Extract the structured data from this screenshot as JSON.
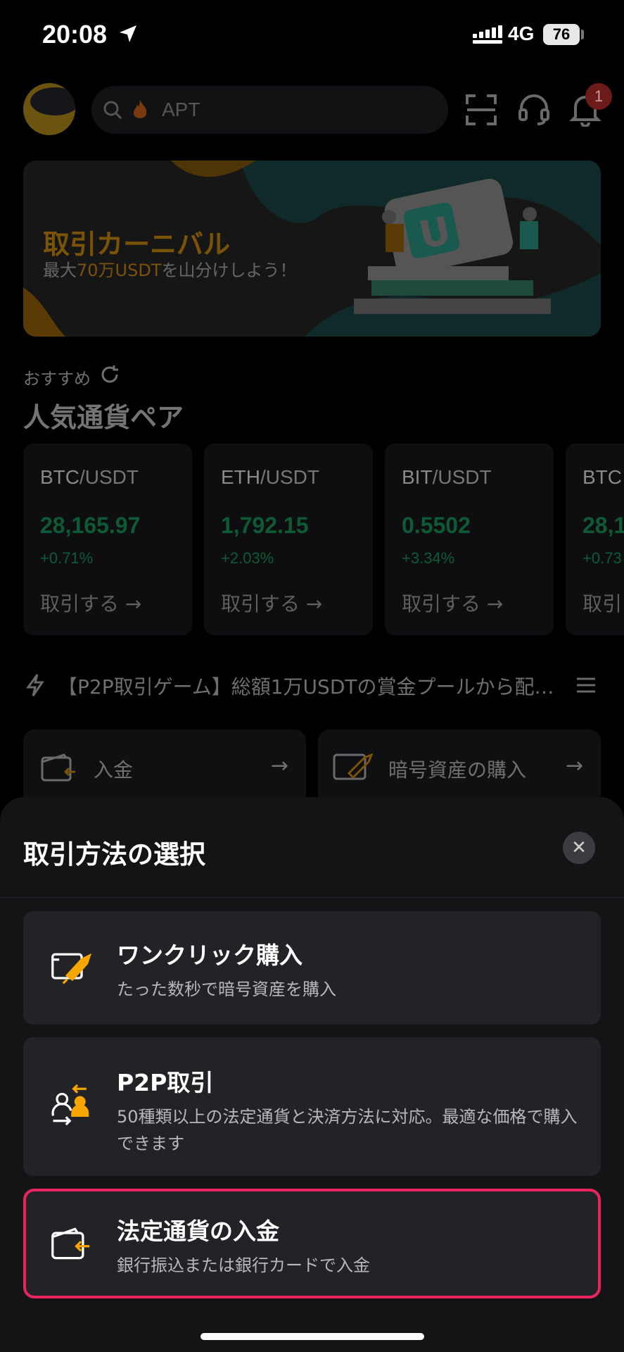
{
  "status_bar": {
    "time": "20:08",
    "network": "4G",
    "battery": "76"
  },
  "header": {
    "search_placeholder": "APT",
    "notification_count": "1"
  },
  "banner": {
    "title": "取引カーニバル",
    "subtitle_prefix": "最大",
    "subtitle_highlight": "70万USDT",
    "subtitle_suffix": "を山分けしよう！"
  },
  "recommend": {
    "label": "おすすめ",
    "heading": "人気通貨ペア"
  },
  "pairs": [
    {
      "base": "BTC",
      "quote": "/USDT",
      "price": "28,165.97",
      "change": "+0.71%",
      "action": "取引する"
    },
    {
      "base": "ETH",
      "quote": "/USDT",
      "price": "1,792.15",
      "change": "+2.03%",
      "action": "取引する"
    },
    {
      "base": "BIT",
      "quote": "/USDT",
      "price": "0.5502",
      "change": "+3.34%",
      "action": "取引する"
    },
    {
      "base": "BTC",
      "quote": "",
      "price": "28,1",
      "change": "+0.73",
      "action": "取引"
    }
  ],
  "announcement": "【P2P取引ゲーム】総額1万USDTの賞金プールから配…",
  "actions": {
    "deposit": "入金",
    "buy_crypto": "暗号資産の購入"
  },
  "sheet": {
    "title": "取引方法の選択",
    "options": [
      {
        "title": "ワンクリック購入",
        "desc": "たった数秒で暗号資産を購入"
      },
      {
        "title": "P2P取引",
        "desc": "50種類以上の法定通貨と決済方法に対応。最適な価格で購入できます"
      },
      {
        "title": "法定通貨の入金",
        "desc": "銀行振込または銀行カードで入金"
      }
    ]
  },
  "colors": {
    "accent": "#f7a600",
    "highlight_border": "#e8245e",
    "positive": "#20b26c"
  }
}
